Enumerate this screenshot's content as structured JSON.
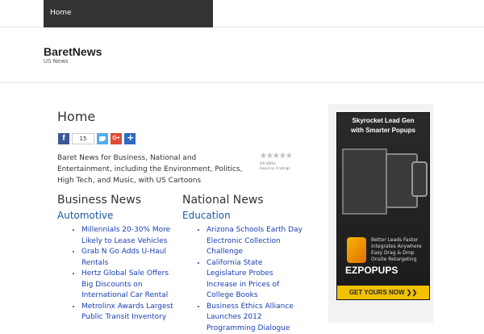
{
  "topnav": {
    "items": [
      "Home"
    ]
  },
  "site": {
    "title": "BaretNews",
    "tagline": "US News"
  },
  "page": {
    "title": "Home",
    "intro": "Baret News for Business, National and Entertainment, including the Environment, Politics, High Tech, and Music, with US Cartoons",
    "share_count": "15",
    "rating": {
      "stars": "★★★★★",
      "summary": "4/5 (80%)",
      "votes": "based on 4 ratings"
    }
  },
  "business": {
    "title": "Business News",
    "section": "Automotive",
    "links": [
      "Millennials 20-30% More Likely to Lease Vehicles",
      "Grab N Go Adds U-Haul Rentals",
      "Hertz Global Sale Offers Big Discounts on International Car Rental",
      "Metrolinx Awards Largest Public Transit Inventory"
    ]
  },
  "national": {
    "title": "National News",
    "section": "Education",
    "links": [
      "Arizona Schools Earth Day Electronic Collection Challenge",
      "California State Legislature Probes Increase in Prices of College Books",
      "Business Ethics Alliance Launches 2012 Programming Dialogue"
    ]
  },
  "ad": {
    "headline": "Skyrocket Lead Gen",
    "headline2": "with Smarter Popups",
    "bullets": [
      "Better Leads Faster",
      "Integrates Anywhere",
      "Easy Drag & Drop",
      "Onsite Retargeting"
    ],
    "brand": "EZPOPUPS",
    "cta": "GET YOURS NOW ❯❯"
  }
}
